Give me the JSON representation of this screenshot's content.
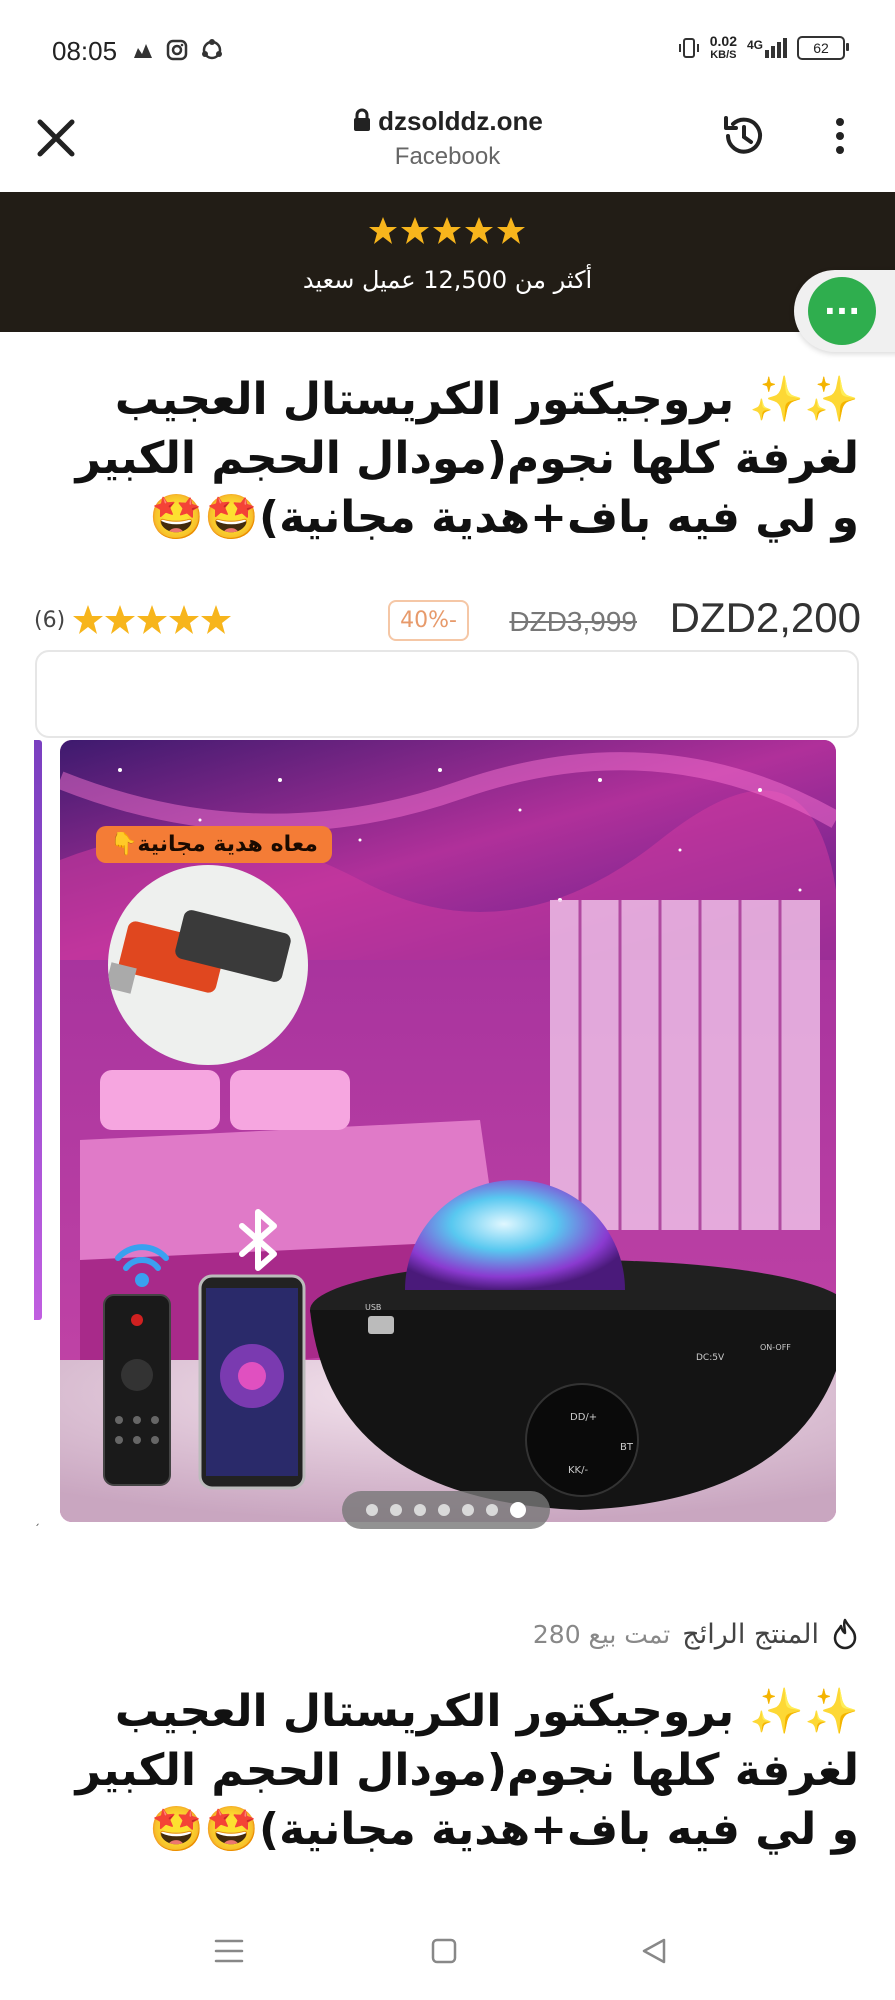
{
  "status_bar": {
    "time": "08:05",
    "net_speed_value": "0.02",
    "net_speed_unit": "KB/S",
    "network_type": "4G",
    "battery": "62"
  },
  "browser": {
    "url": "dzsolddz.one",
    "referrer": "Facebook"
  },
  "banner": {
    "stars": 5,
    "text": "أكثر من 12,500 عميل سعيد"
  },
  "chat_fab": {
    "label": "···"
  },
  "product": {
    "title_line1": "✨✨ بروجيكتور الكريستال العجيب",
    "title_line2": "لغرفة كلها نجوم(مودال الحجم الكبير",
    "title_line3": "و لي فيه باف+هدية مجانية)🤩🤩",
    "price_current": "DZD2,200",
    "price_old": "DZD3,999",
    "discount": "40%-",
    "rating_count": "(6)",
    "rating_stars": 5
  },
  "gallery": {
    "gift_tag": "معاه هدية مجانية👇",
    "slide_count": 7,
    "active_slide": 7,
    "device_labels": {
      "usb": "USB",
      "dc": "DC:5V",
      "onoff": "ON-OFF",
      "bt": "BT",
      "dd": "DD/+",
      "kk": "KK/-"
    }
  },
  "trending": {
    "label": "المنتج الرائج",
    "sold": "تمت بيع 280"
  },
  "product_repeat": {
    "title_line1": "✨✨ بروجيكتور الكريستال العجيب",
    "title_line2": "لغرفة كلها نجوم(مودال الحجم الكبير",
    "title_line3": "و لي فيه باف+هدية مجانية)🤩🤩"
  },
  "colors": {
    "banner_bg": "#221d16",
    "star": "#f7b51c",
    "chat_green": "#2fae4e",
    "discount_text": "#e79a6b"
  }
}
